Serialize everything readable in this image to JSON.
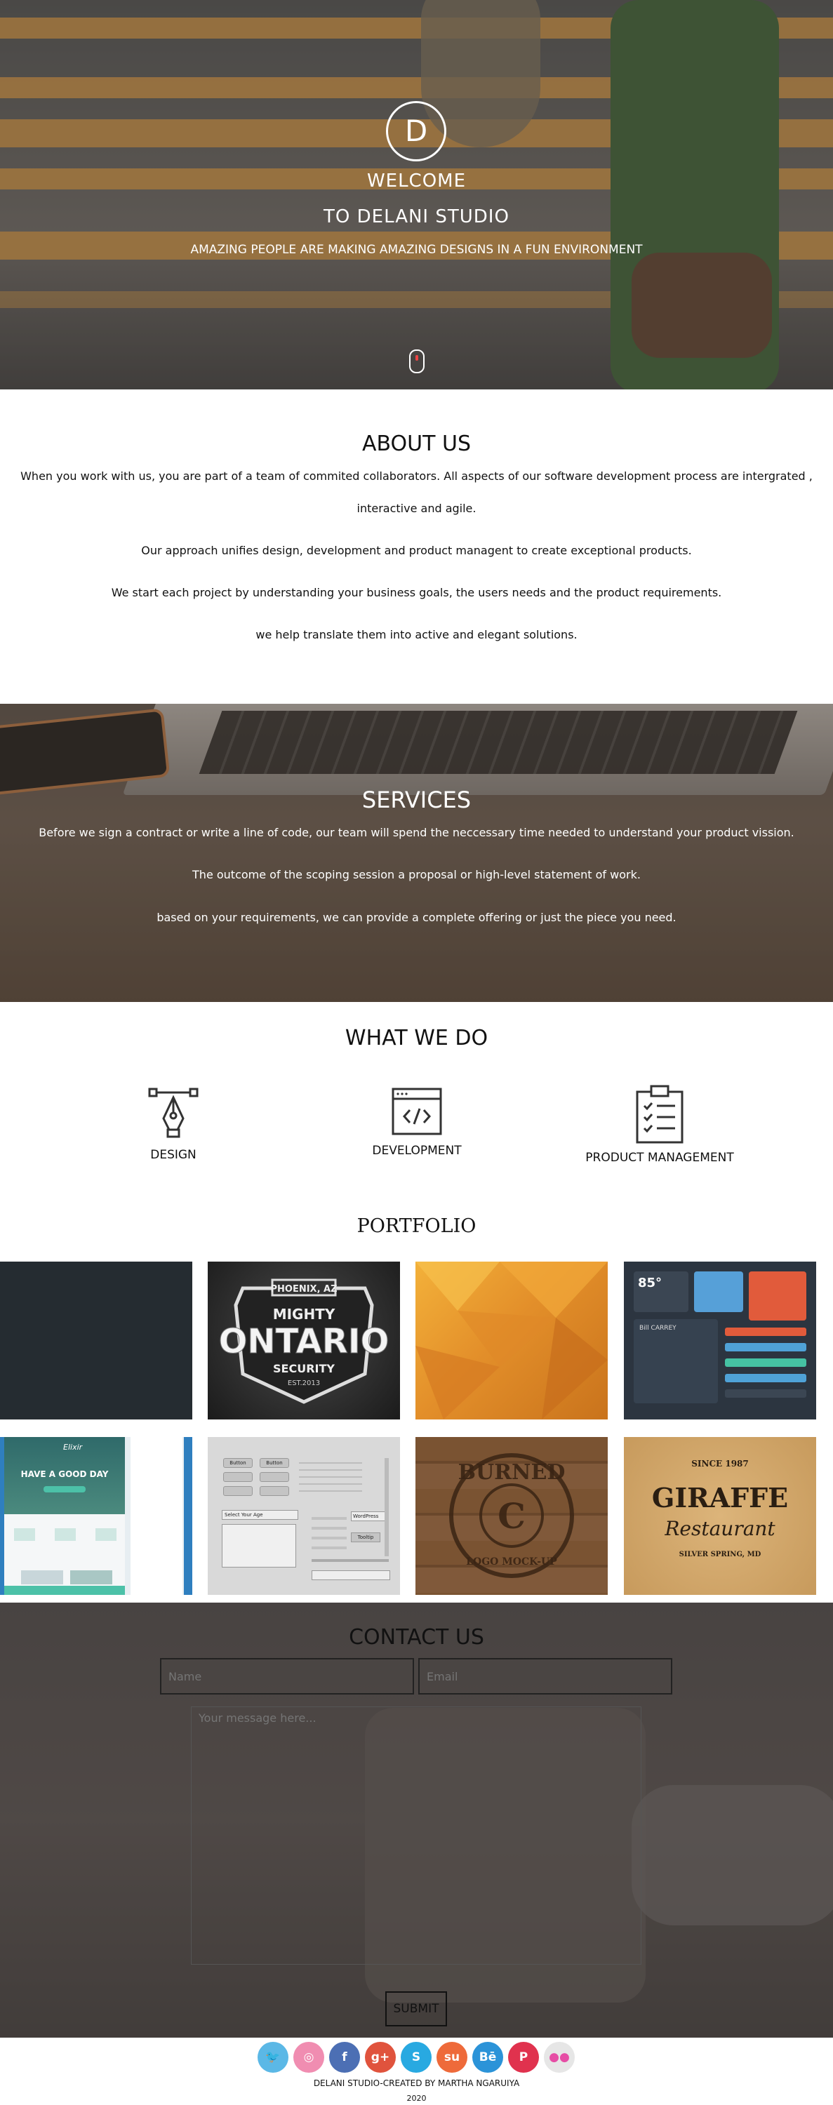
{
  "hero": {
    "logo_letter": "D",
    "title_line1": "WELCOME",
    "title_line2": "TO DELANI STUDIO",
    "subtitle": "AMAZING PEOPLE ARE MAKING AMAZING DESIGNS IN A FUN ENVIRONMENT"
  },
  "about": {
    "heading": "ABOUT US",
    "paragraph1_line1": "When you work with us, you are part of a team of commited collaborators. All aspects of our software development process are intergrated ,",
    "paragraph1_line2": "interactive and agile.",
    "paragraph2": "Our approach unifies design, development and product managent to create exceptional products.",
    "paragraph3": "We start each project by understanding your business goals, the users needs and the product requirements.",
    "paragraph4": "we help translate them into active and elegant solutions."
  },
  "services": {
    "heading": "SERVICES",
    "paragraph1": "Before we sign a contract or write a line of code, our team will spend the neccessary time needed to understand your product vission.",
    "paragraph2": "The outcome of the scoping session a proposal or high-level statement of work.",
    "paragraph3": "based on your requirements, we can provide a complete offering or just the piece you need."
  },
  "what_we_do": {
    "heading": "WHAT WE DO",
    "items": [
      {
        "label": "DESIGN",
        "icon": "pen-tool-icon"
      },
      {
        "label": "DEVELOPMENT",
        "icon": "code-window-icon"
      },
      {
        "label": "PRODUCT MANAGEMENT",
        "icon": "clipboard-checklist-icon"
      }
    ]
  },
  "portfolio": {
    "heading": "PORTFOLIO",
    "badge_top": "PHOENIX, AZ",
    "badge_mighty": "MIGHTY",
    "badge_main": "ONTARIO",
    "badge_security": "SECURITY",
    "badge_est": "EST.2013",
    "app_temp": "85°",
    "app_name": "Bill CARREY",
    "web_title": "HAVE A GOOD DAY",
    "web_brand": "Elixir",
    "burned_top": "BURNED",
    "burned_bottom": "LOGO MOCK-UP",
    "burned_letter": "C",
    "giraffe_since": "SINCE 1987",
    "giraffe_main": "GIRAFFE",
    "giraffe_sub": "Restaurant",
    "giraffe_loc": "SILVER SPRING, MD",
    "ui_button": "Button",
    "ui_select": "Select Your Age",
    "ui_wordpress": "WordPress",
    "ui_tooltip": "Tooltip"
  },
  "contact": {
    "heading": "CONTACT US",
    "name_placeholder": "Name",
    "email_placeholder": "Email",
    "message_placeholder": "Your message here...",
    "submit_label": "SUBMIT"
  },
  "footer": {
    "social": [
      {
        "name": "twitter-icon",
        "glyph": "🐦",
        "color": "#5bb8e6"
      },
      {
        "name": "dribbble-icon",
        "glyph": "◎",
        "color": "#f08db1"
      },
      {
        "name": "facebook-icon",
        "glyph": "f",
        "color": "#4c6fb4"
      },
      {
        "name": "google-plus-icon",
        "glyph": "g+",
        "color": "#e0533d"
      },
      {
        "name": "skype-icon",
        "glyph": "S",
        "color": "#28a9e1"
      },
      {
        "name": "stumbleupon-icon",
        "glyph": "su",
        "color": "#ee6a3a"
      },
      {
        "name": "behance-icon",
        "glyph": "Bē",
        "color": "#2b93d8"
      },
      {
        "name": "pinterest-icon",
        "glyph": "P",
        "color": "#e0324e"
      },
      {
        "name": "flickr-icon",
        "glyph": "●●",
        "color": "#e6e6e6"
      }
    ],
    "credit": "DELANI STUDIO-CREATED BY MARTHA NGARUIYA",
    "year": "2020"
  },
  "colors": {
    "hero_stripe": "#e2a04a",
    "text_dark": "#111111"
  }
}
